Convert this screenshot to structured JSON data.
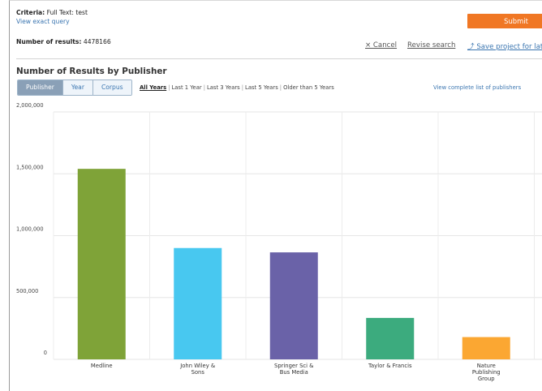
{
  "criteria": {
    "label": "Criteria:",
    "value": "Full Text: test",
    "view_query": "View exact query"
  },
  "results": {
    "label": "Number of results:",
    "value": "4478166"
  },
  "submit_label": "Submit",
  "actions": {
    "cancel": "× Cancel",
    "revise": "Revise search",
    "save": "⤴ Save project for later"
  },
  "section_title": "Number of Results by Publisher",
  "group_tabs": [
    "Publisher",
    "Year",
    "Corpus"
  ],
  "active_group_tab": "Publisher",
  "time_ranges": [
    "All Years",
    "Last 1 Year",
    "Last 3 Years",
    "Last 5 Years",
    "Older than 5 Years"
  ],
  "active_time_range": "All Years",
  "view_complete_list": "View complete list of publishers",
  "chart_data": {
    "type": "bar",
    "ylim": [
      0,
      2000000
    ],
    "y_ticks": [
      "2,000,000",
      "1,500,000",
      "1,000,000",
      "500,000",
      "0"
    ],
    "y_tick_values": [
      2000000,
      1500000,
      1000000,
      500000,
      0
    ],
    "grid": true,
    "bars": [
      {
        "category": [
          "Medline"
        ],
        "value": 1540000,
        "color": "#7fa338"
      },
      {
        "category": [
          "John Wiley &",
          "Sons"
        ],
        "value": 900000,
        "color": "#48c8f0"
      },
      {
        "category": [
          "Springer Sci &",
          "Bus Media"
        ],
        "value": 865000,
        "color": "#6a62a8"
      },
      {
        "category": [
          "Taylor & Francis"
        ],
        "value": 335000,
        "color": "#3cab7e"
      },
      {
        "category": [
          "Nature",
          "Publishing",
          "Group"
        ],
        "value": 180000,
        "color": "#fba732"
      }
    ]
  }
}
